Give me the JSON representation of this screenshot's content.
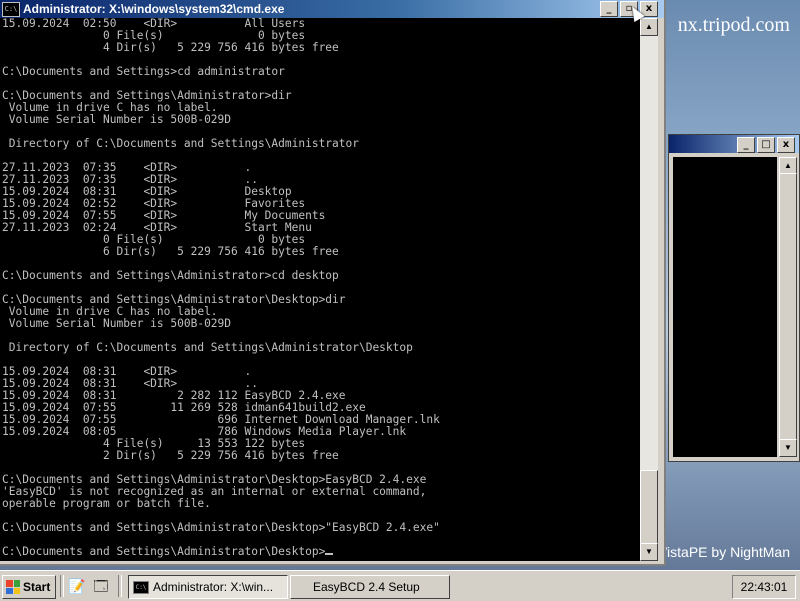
{
  "desktop": {
    "url_fragment": "nx.tripod.com",
    "brand": "VistaPE by NightMan"
  },
  "cmd_window": {
    "icon_text": "C:\\",
    "title": "Administrator: X:\\windows\\system32\\cmd.exe",
    "buttons": {
      "minimize": "_",
      "restore": "▫",
      "close": "x"
    },
    "console_lines": [
      "15.09.2024  02:50    <DIR>          All Users",
      "               0 File(s)              0 bytes",
      "               4 Dir(s)   5 229 756 416 bytes free",
      "",
      "C:\\Documents and Settings>cd administrator",
      "",
      "C:\\Documents and Settings\\Administrator>dir",
      " Volume in drive C has no label.",
      " Volume Serial Number is 500B-029D",
      "",
      " Directory of C:\\Documents and Settings\\Administrator",
      "",
      "27.11.2023  07:35    <DIR>          .",
      "27.11.2023  07:35    <DIR>          ..",
      "15.09.2024  08:31    <DIR>          Desktop",
      "15.09.2024  02:52    <DIR>          Favorites",
      "15.09.2024  07:55    <DIR>          My Documents",
      "27.11.2023  02:24    <DIR>          Start Menu",
      "               0 File(s)              0 bytes",
      "               6 Dir(s)   5 229 756 416 bytes free",
      "",
      "C:\\Documents and Settings\\Administrator>cd desktop",
      "",
      "C:\\Documents and Settings\\Administrator\\Desktop>dir",
      " Volume in drive C has no label.",
      " Volume Serial Number is 500B-029D",
      "",
      " Directory of C:\\Documents and Settings\\Administrator\\Desktop",
      "",
      "15.09.2024  08:31    <DIR>          .",
      "15.09.2024  08:31    <DIR>          ..",
      "15.09.2024  08:31         2 282 112 EasyBCD 2.4.exe",
      "15.09.2024  07:55        11 269 528 idman641build2.exe",
      "15.09.2024  07:55               696 Internet Download Manager.lnk",
      "15.09.2024  08:05               786 Windows Media Player.lnk",
      "               4 File(s)     13 553 122 bytes",
      "               2 Dir(s)   5 229 756 416 bytes free",
      "",
      "C:\\Documents and Settings\\Administrator\\Desktop>EasyBCD 2.4.exe",
      "'EasyBCD' is not recognized as an internal or external command,",
      "operable program or batch file.",
      "",
      "C:\\Documents and Settings\\Administrator\\Desktop>\"EasyBCD 2.4.exe\"",
      ""
    ],
    "prompt_line": "C:\\Documents and Settings\\Administrator\\Desktop>"
  },
  "setup_window": {
    "buttons": {
      "minimize": "_",
      "maximize": "□",
      "close": "x"
    }
  },
  "taskbar": {
    "start_label": "Start",
    "tasks": [
      {
        "label": "Administrator: X:\\win...",
        "icon": "C:\\"
      },
      {
        "label": "EasyBCD 2.4 Setup"
      }
    ],
    "clock": "22:43:01"
  }
}
